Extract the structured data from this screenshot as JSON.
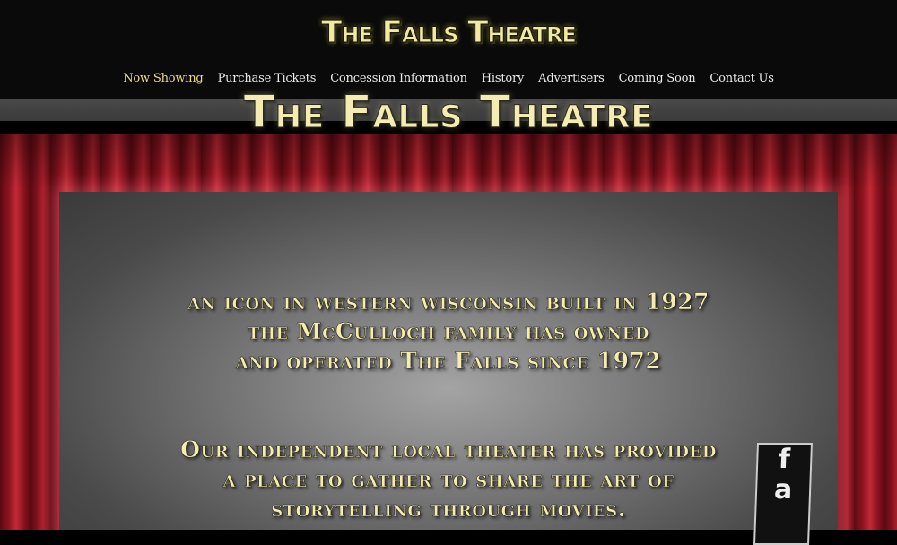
{
  "site": {
    "logo": "The Falls Theatre"
  },
  "nav": [
    {
      "label": "Now Showing",
      "active": true
    },
    {
      "label": "Purchase Tickets"
    },
    {
      "label": "Concession Information"
    },
    {
      "label": "History"
    },
    {
      "label": "Advertisers"
    },
    {
      "label": "Coming Soon"
    },
    {
      "label": "Contact Us"
    }
  ],
  "hero": {
    "title": "The Falls Theatre",
    "tagline_lines": [
      "an icon in western wisconsin built in 1927",
      "the McCulloch family has owned",
      "and operated The Falls since 1972"
    ],
    "mission_lines": [
      "Our independent local theater has provided",
      "a place to gather to share the art of",
      "storytelling through movies."
    ],
    "badge_letters": [
      "f",
      "a"
    ]
  },
  "colors": {
    "accent": "#ecd98a",
    "curtain": "#8e1420",
    "header_bg": "#0a0a0a"
  }
}
